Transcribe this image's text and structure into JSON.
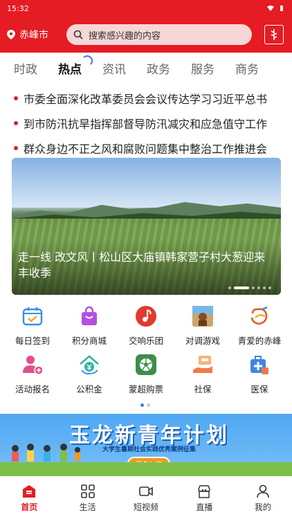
{
  "status": {
    "time": "15:32"
  },
  "header": {
    "location": "赤峰市",
    "search_placeholder": "搜索感兴趣的内容"
  },
  "tabs": [
    {
      "label": "时政"
    },
    {
      "label": "热点"
    },
    {
      "label": "资讯"
    },
    {
      "label": "政务"
    },
    {
      "label": "服务"
    },
    {
      "label": "商务"
    }
  ],
  "news": [
    "市委全面深化改革委员会会议传达学习习近平总书",
    "到市防汛抗旱指挥部督导防汛减灾和应急值守工作",
    "群众身边不正之风和腐败问题集中整治工作推进会"
  ],
  "banner": {
    "caption": "走一线 改文风丨松山区大庙镇韩家营子村大葱迎来丰收季"
  },
  "grid": [
    {
      "label": "每日签到",
      "icon": "calendar-check-icon",
      "color": "#3a8ee6"
    },
    {
      "label": "积分商城",
      "icon": "shopping-bag-icon",
      "color": "#b44fe0"
    },
    {
      "label": "交响乐团",
      "icon": "music-note-icon",
      "color": "#e23a2e"
    },
    {
      "label": "对调游戏",
      "icon": "game-tile-icon",
      "color": "#8a6a3b"
    },
    {
      "label": "青爱的赤峰",
      "icon": "heart-logo-icon",
      "color": "#e35a2a"
    },
    {
      "label": "活动报名",
      "icon": "user-add-icon",
      "color": "#e0508a"
    },
    {
      "label": "公积金",
      "icon": "house-coin-icon",
      "color": "#2fb3a2"
    },
    {
      "label": "蒙超购票",
      "icon": "soccer-ball-icon",
      "color": "#3b8f4a"
    },
    {
      "label": "社保",
      "icon": "hand-card-icon",
      "color": "#f07a4a"
    },
    {
      "label": "医保",
      "icon": "medical-kit-icon",
      "color": "#3f86e0"
    }
  ],
  "promo": {
    "title": "玉龙新青年计划",
    "subtitle": "大学生暑期社会实践优秀案例征集",
    "button": "报名入口"
  },
  "tabbar": [
    {
      "label": "首页",
      "icon": "home-icon"
    },
    {
      "label": "生活",
      "icon": "grid-icon"
    },
    {
      "label": "短视频",
      "icon": "video-icon"
    },
    {
      "label": "直播",
      "icon": "live-store-icon"
    },
    {
      "label": "我的",
      "icon": "user-icon"
    }
  ],
  "colors": {
    "brand": "#e51c23",
    "active_tab": "#e51c23"
  }
}
